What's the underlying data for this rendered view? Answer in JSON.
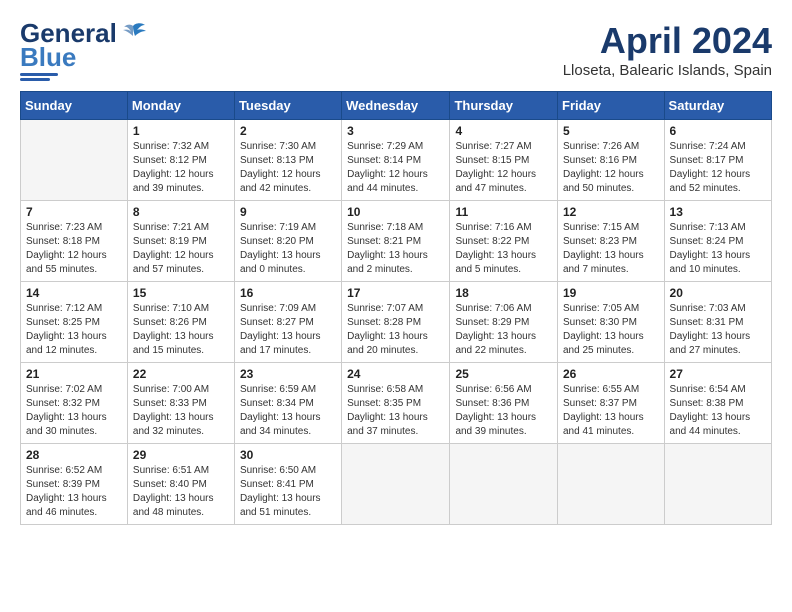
{
  "header": {
    "logo_general": "General",
    "logo_blue": "Blue",
    "month_title": "April 2024",
    "location": "Lloseta, Balearic Islands, Spain"
  },
  "calendar": {
    "days_of_week": [
      "Sunday",
      "Monday",
      "Tuesday",
      "Wednesday",
      "Thursday",
      "Friday",
      "Saturday"
    ],
    "weeks": [
      [
        {
          "day": "",
          "info": ""
        },
        {
          "day": "1",
          "info": "Sunrise: 7:32 AM\nSunset: 8:12 PM\nDaylight: 12 hours\nand 39 minutes."
        },
        {
          "day": "2",
          "info": "Sunrise: 7:30 AM\nSunset: 8:13 PM\nDaylight: 12 hours\nand 42 minutes."
        },
        {
          "day": "3",
          "info": "Sunrise: 7:29 AM\nSunset: 8:14 PM\nDaylight: 12 hours\nand 44 minutes."
        },
        {
          "day": "4",
          "info": "Sunrise: 7:27 AM\nSunset: 8:15 PM\nDaylight: 12 hours\nand 47 minutes."
        },
        {
          "day": "5",
          "info": "Sunrise: 7:26 AM\nSunset: 8:16 PM\nDaylight: 12 hours\nand 50 minutes."
        },
        {
          "day": "6",
          "info": "Sunrise: 7:24 AM\nSunset: 8:17 PM\nDaylight: 12 hours\nand 52 minutes."
        }
      ],
      [
        {
          "day": "7",
          "info": "Sunrise: 7:23 AM\nSunset: 8:18 PM\nDaylight: 12 hours\nand 55 minutes."
        },
        {
          "day": "8",
          "info": "Sunrise: 7:21 AM\nSunset: 8:19 PM\nDaylight: 12 hours\nand 57 minutes."
        },
        {
          "day": "9",
          "info": "Sunrise: 7:19 AM\nSunset: 8:20 PM\nDaylight: 13 hours\nand 0 minutes."
        },
        {
          "day": "10",
          "info": "Sunrise: 7:18 AM\nSunset: 8:21 PM\nDaylight: 13 hours\nand 2 minutes."
        },
        {
          "day": "11",
          "info": "Sunrise: 7:16 AM\nSunset: 8:22 PM\nDaylight: 13 hours\nand 5 minutes."
        },
        {
          "day": "12",
          "info": "Sunrise: 7:15 AM\nSunset: 8:23 PM\nDaylight: 13 hours\nand 7 minutes."
        },
        {
          "day": "13",
          "info": "Sunrise: 7:13 AM\nSunset: 8:24 PM\nDaylight: 13 hours\nand 10 minutes."
        }
      ],
      [
        {
          "day": "14",
          "info": "Sunrise: 7:12 AM\nSunset: 8:25 PM\nDaylight: 13 hours\nand 12 minutes."
        },
        {
          "day": "15",
          "info": "Sunrise: 7:10 AM\nSunset: 8:26 PM\nDaylight: 13 hours\nand 15 minutes."
        },
        {
          "day": "16",
          "info": "Sunrise: 7:09 AM\nSunset: 8:27 PM\nDaylight: 13 hours\nand 17 minutes."
        },
        {
          "day": "17",
          "info": "Sunrise: 7:07 AM\nSunset: 8:28 PM\nDaylight: 13 hours\nand 20 minutes."
        },
        {
          "day": "18",
          "info": "Sunrise: 7:06 AM\nSunset: 8:29 PM\nDaylight: 13 hours\nand 22 minutes."
        },
        {
          "day": "19",
          "info": "Sunrise: 7:05 AM\nSunset: 8:30 PM\nDaylight: 13 hours\nand 25 minutes."
        },
        {
          "day": "20",
          "info": "Sunrise: 7:03 AM\nSunset: 8:31 PM\nDaylight: 13 hours\nand 27 minutes."
        }
      ],
      [
        {
          "day": "21",
          "info": "Sunrise: 7:02 AM\nSunset: 8:32 PM\nDaylight: 13 hours\nand 30 minutes."
        },
        {
          "day": "22",
          "info": "Sunrise: 7:00 AM\nSunset: 8:33 PM\nDaylight: 13 hours\nand 32 minutes."
        },
        {
          "day": "23",
          "info": "Sunrise: 6:59 AM\nSunset: 8:34 PM\nDaylight: 13 hours\nand 34 minutes."
        },
        {
          "day": "24",
          "info": "Sunrise: 6:58 AM\nSunset: 8:35 PM\nDaylight: 13 hours\nand 37 minutes."
        },
        {
          "day": "25",
          "info": "Sunrise: 6:56 AM\nSunset: 8:36 PM\nDaylight: 13 hours\nand 39 minutes."
        },
        {
          "day": "26",
          "info": "Sunrise: 6:55 AM\nSunset: 8:37 PM\nDaylight: 13 hours\nand 41 minutes."
        },
        {
          "day": "27",
          "info": "Sunrise: 6:54 AM\nSunset: 8:38 PM\nDaylight: 13 hours\nand 44 minutes."
        }
      ],
      [
        {
          "day": "28",
          "info": "Sunrise: 6:52 AM\nSunset: 8:39 PM\nDaylight: 13 hours\nand 46 minutes."
        },
        {
          "day": "29",
          "info": "Sunrise: 6:51 AM\nSunset: 8:40 PM\nDaylight: 13 hours\nand 48 minutes."
        },
        {
          "day": "30",
          "info": "Sunrise: 6:50 AM\nSunset: 8:41 PM\nDaylight: 13 hours\nand 51 minutes."
        },
        {
          "day": "",
          "info": ""
        },
        {
          "day": "",
          "info": ""
        },
        {
          "day": "",
          "info": ""
        },
        {
          "day": "",
          "info": ""
        }
      ]
    ]
  }
}
